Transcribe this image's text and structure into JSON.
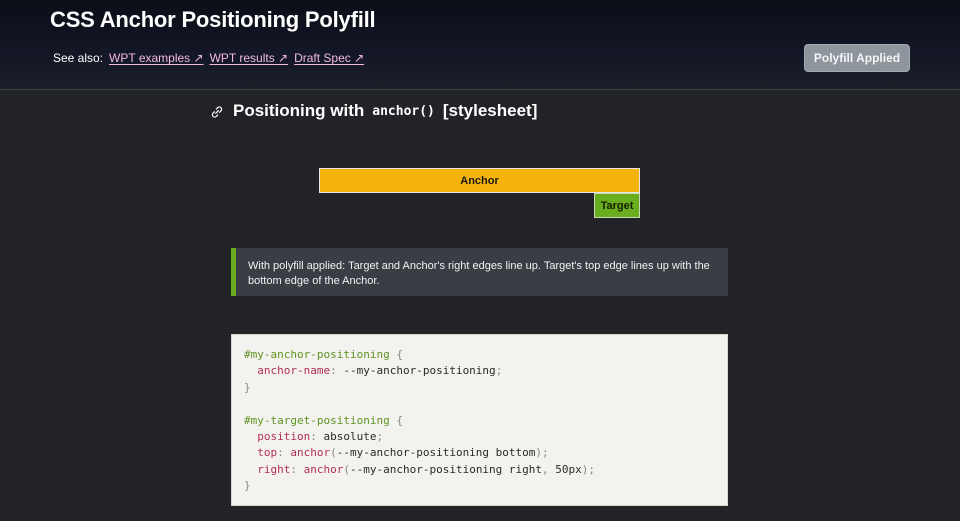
{
  "header": {
    "title": "CSS Anchor Positioning Polyfill",
    "see_also_label": "See also:",
    "links": [
      {
        "label": "WPT examples ↗"
      },
      {
        "label": "WPT results ↗"
      },
      {
        "label": "Draft Spec ↗"
      }
    ],
    "applied_button": "Polyfill Applied"
  },
  "section": {
    "title_prefix": "Positioning with",
    "title_code": "anchor()",
    "title_suffix": "[stylesheet]"
  },
  "demo": {
    "anchor_label": "Anchor",
    "target_label": "Target"
  },
  "note": {
    "text": "With polyfill applied: Target and Anchor's right edges line up. Target's top edge lines up with the bottom edge of the Anchor."
  },
  "code": {
    "l1_sel": "#my-anchor-positioning",
    "l1_brace": " {",
    "l2_prop": "anchor-name",
    "l2_colon": ":",
    "l2_val": " --my-anchor-positioning",
    "l2_semi": ";",
    "l3": "}",
    "l5_sel": "#my-target-positioning",
    "l5_brace": " {",
    "l6_prop": "position",
    "l6_colon": ":",
    "l6_val": " absolute",
    "l6_semi": ";",
    "l7_prop": "top",
    "l7_colon": ":",
    "l7_fn": " anchor",
    "l7_open": "(",
    "l7_args": "--my-anchor-positioning bottom",
    "l7_close": ");",
    "l8_prop": "right",
    "l8_colon": ":",
    "l8_fn": " anchor",
    "l8_open": "(",
    "l8_args": "--my-anchor-positioning right",
    "l8_comma": ",",
    "l8_arg2": " 50px",
    "l8_close": ");",
    "l9": "}"
  },
  "colors": {
    "anchor": "#f5b30b",
    "target": "#6aae1f",
    "link": "#f3b8e6"
  }
}
